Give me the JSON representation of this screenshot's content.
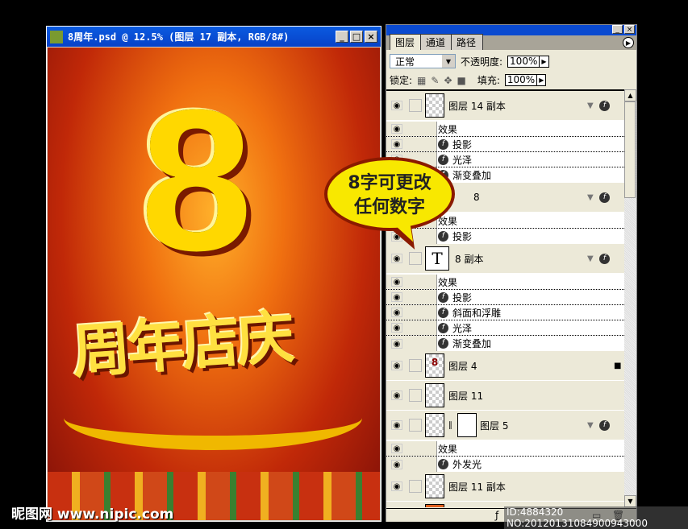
{
  "document_window": {
    "title": "8周年.psd @ 12.5% (图层 17 副本, RGB/8#)",
    "min": "_",
    "max": "□",
    "close": "×"
  },
  "artwork": {
    "numeral": "8",
    "headline": "周年店庆"
  },
  "watermark": "昵图网 www.nipic.com",
  "callout": {
    "line1": "8字可更改",
    "line2": "任何数字"
  },
  "layers_panel": {
    "tabs": [
      "图层",
      "通道",
      "路径"
    ],
    "blend_mode": "正常",
    "opacity_label": "不透明度:",
    "opacity": "100%",
    "lock_label": "锁定:",
    "fill_label": "填充:",
    "fill": "100%",
    "layers": [
      {
        "name": "图层 14 副本",
        "effects_label": "效果",
        "effects": [
          "投影",
          "光泽",
          "渐变叠加"
        ]
      },
      {
        "name": "8",
        "effects_label": "效果",
        "effects": [
          "投影"
        ]
      },
      {
        "name": "8 副本",
        "thumb": "T",
        "effects_label": "效果",
        "effects": [
          "投影",
          "斜面和浮雕",
          "光泽",
          "渐变叠加"
        ]
      },
      {
        "name": "图层 4",
        "thumb": "8"
      },
      {
        "name": "图层 11"
      },
      {
        "name": "图层 5",
        "effects_label": "效果",
        "effects": [
          "外发光"
        ]
      },
      {
        "name": "图层 11 副本"
      }
    ]
  },
  "id_text": "ID:4884320 NO:20120131084900943000"
}
